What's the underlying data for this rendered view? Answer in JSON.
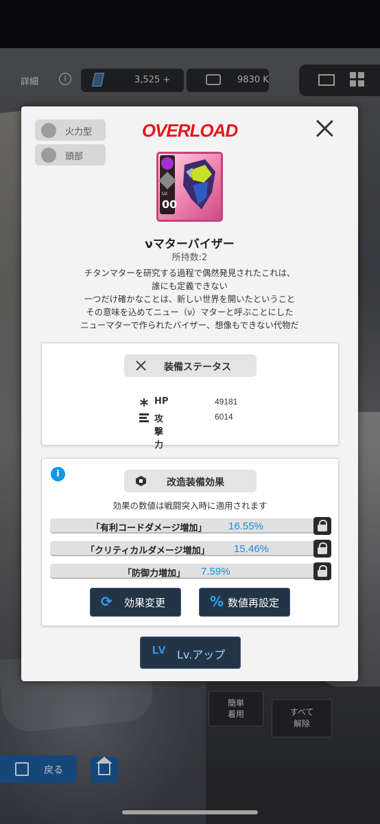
{
  "background": {
    "detail_label": "詳細",
    "info_symbol": "i",
    "gems": "3,525 +",
    "cards": "9830 K",
    "back_label": "戻る",
    "easy_equip": "簡単\n着用",
    "release_all": "すべて\n解除"
  },
  "modal": {
    "title_logo": "OVERLOAD",
    "tags": [
      "火力型",
      "頭部"
    ],
    "item": {
      "level": "00",
      "level_label": "LV.",
      "name": "νマターバイザー",
      "owned": "所持数:2",
      "description": [
        "チタンマターを研究する過程で偶然発見されたこれは、",
        "誰にも定義できない",
        "一つだけ確かなことは、新しい世界を開いたということ",
        "その意味を込めてニュー（ν）マターと呼ぶことにした",
        "ニューマターで作られたバイザー、想像もできない代物だ"
      ]
    },
    "equip_status": {
      "title": "装備ステータス",
      "stats": [
        {
          "label": "HP",
          "value": "49181",
          "icon": "asterisk-icon"
        },
        {
          "label": "攻撃力",
          "value": "6014",
          "icon": "bars-icon"
        }
      ]
    },
    "mod_effects": {
      "title": "改造装備効果",
      "note": "効果の数値は戦闘突入時に適用されます",
      "effects": [
        {
          "name": "「有利コードダメージ増加」",
          "value": "16.55%"
        },
        {
          "name": "「クリティカルダメージ増加」",
          "value": "15.46%"
        },
        {
          "name": "「防御力増加」",
          "value": "7.59%"
        }
      ],
      "change_button": "効果変更",
      "reset_button": "数値再設定"
    },
    "lvup_button": "Lv.アップ",
    "lvup_icon_text": "LV"
  },
  "colors": {
    "accent_red": "#e4161e",
    "value_blue": "#1c8bd6",
    "button_dark": "#243447",
    "info_blue": "#1296e8"
  }
}
